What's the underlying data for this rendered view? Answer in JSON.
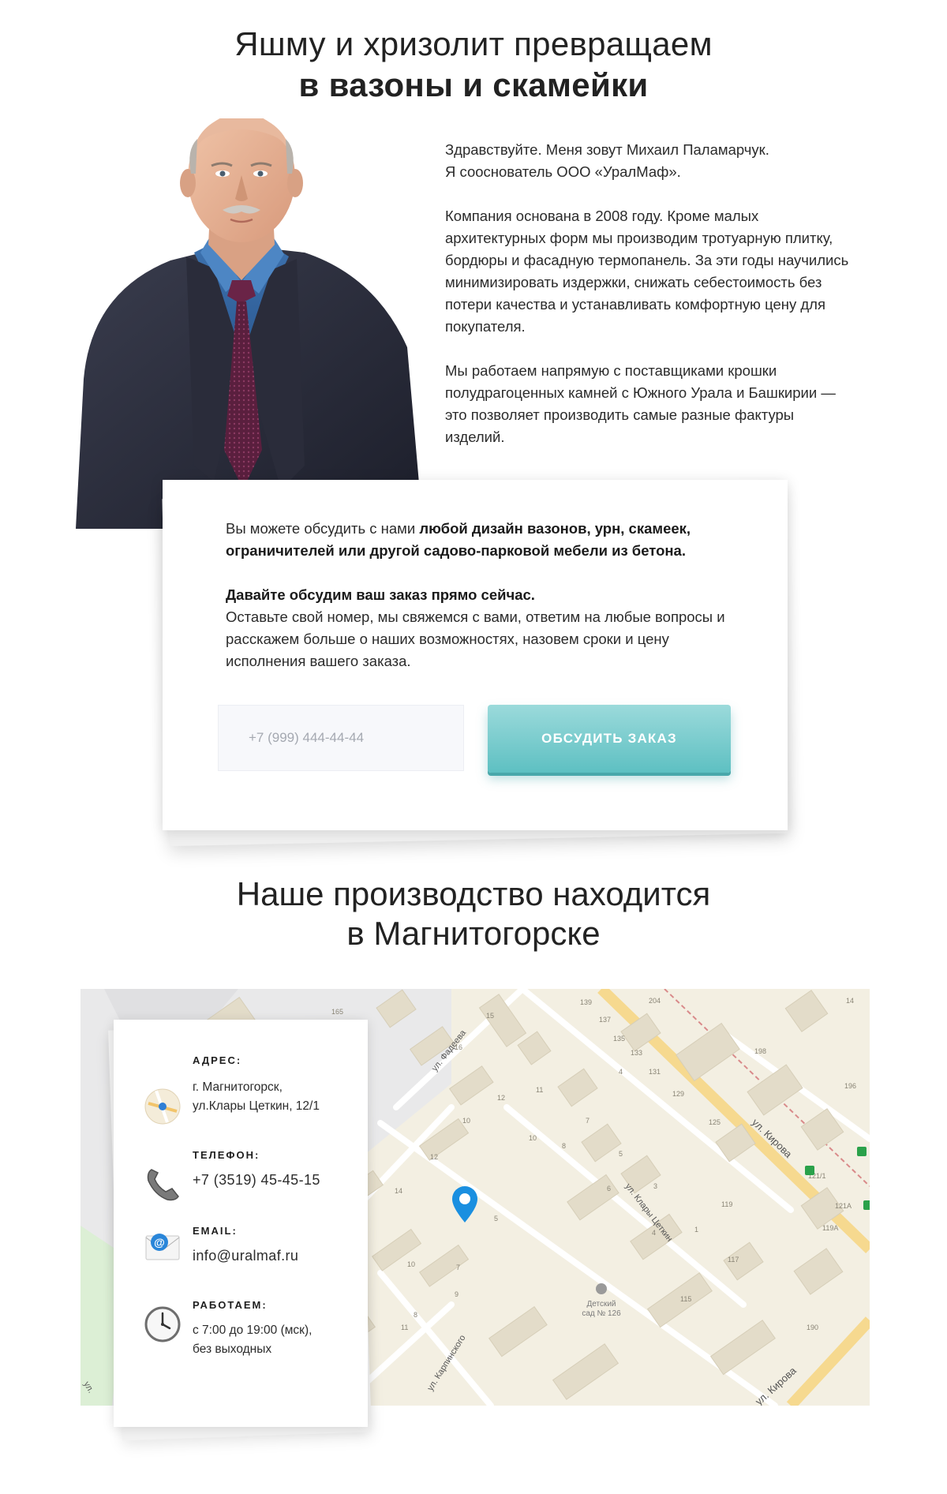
{
  "hero": {
    "title_line1": "Яшму и хризолит превращаем",
    "title_line2": "в вазоны и скамейки"
  },
  "intro": {
    "paragraph1_line1": "Здравствуйте. Меня зовут Михаил Паламарчук.",
    "paragraph1_line2": "Я сооснователь ООО «УралМаф».",
    "paragraph2": "Компания основана в 2008 году. Кроме малых архитектурных форм мы производим тротуарную плитку, бордюры и фасадную термопанель. За эти годы научились минимизировать издержки, снижать себестоимость без потери качества и устанавливать комфортную цену для покупателя.",
    "paragraph3": "Мы работаем напрямую с поставщиками крошки полудрагоценных камней с Южного Урала и Башкирии — это позволяет  производить самые разные фактуры изделий."
  },
  "order_card": {
    "text_prefix": "Вы можете обсудить с нами ",
    "text_bold": "любой дизайн вазонов, урн, скамеек, ограничителей или другой садово-парковой мебели из бетона.",
    "cta_heading": "Давайте обсудим ваш заказ прямо сейчас.",
    "cta_text": "Оставьте свой номер, мы свяжемся с вами, ответим на любые вопросы и расскажем больше о наших возможностях, назовем сроки и цену исполнения вашего заказа.",
    "phone_placeholder": "+7 (999) 444-44-44",
    "button_label": "Обсудить заказ",
    "accent_color": "#5ec0c2"
  },
  "location": {
    "title_line1": "Наше производство находится",
    "title_line2": "в Магнитогорске"
  },
  "contacts": {
    "address_label": "Адрес:",
    "address_line1": "г. Магнитогорск,",
    "address_line2": "ул.Клары Цеткин, 12/1",
    "phone_label": "Телефон:",
    "phone_value": "+7 (3519) 45-45-15",
    "email_label": "Email:",
    "email_value": "info@uralmaf.ru",
    "hours_label": "Работаем:",
    "hours_line1": "с 7:00 до 19:00 (мск),",
    "hours_line2": "без выходных",
    "icons": [
      "map-pin-icon",
      "telephone-icon",
      "email-envelope-icon",
      "clock-icon"
    ]
  },
  "map": {
    "streets": [
      "ул. Фадеева",
      "ул. Клары Цеткин",
      "ул. Кирова",
      "ул. Карпинского",
      "ул. Кирова",
      "ул."
    ],
    "house_numbers": [
      "165",
      "15",
      "16",
      "12",
      "10",
      "11",
      "10",
      "12",
      "14",
      "139",
      "137",
      "135",
      "133",
      "204",
      "4",
      "131",
      "129",
      "198",
      "14",
      "196",
      "125",
      "7",
      "8",
      "5",
      "6",
      "3",
      "121/1",
      "119",
      "121А",
      "119А",
      "117",
      "4",
      "1",
      "5",
      "7",
      "10",
      "8",
      "9",
      "115",
      "190",
      "11"
    ],
    "poi_label_line1": "Детский",
    "poi_label_line2": "сад № 126",
    "marker_color": "#1a8fe0"
  }
}
